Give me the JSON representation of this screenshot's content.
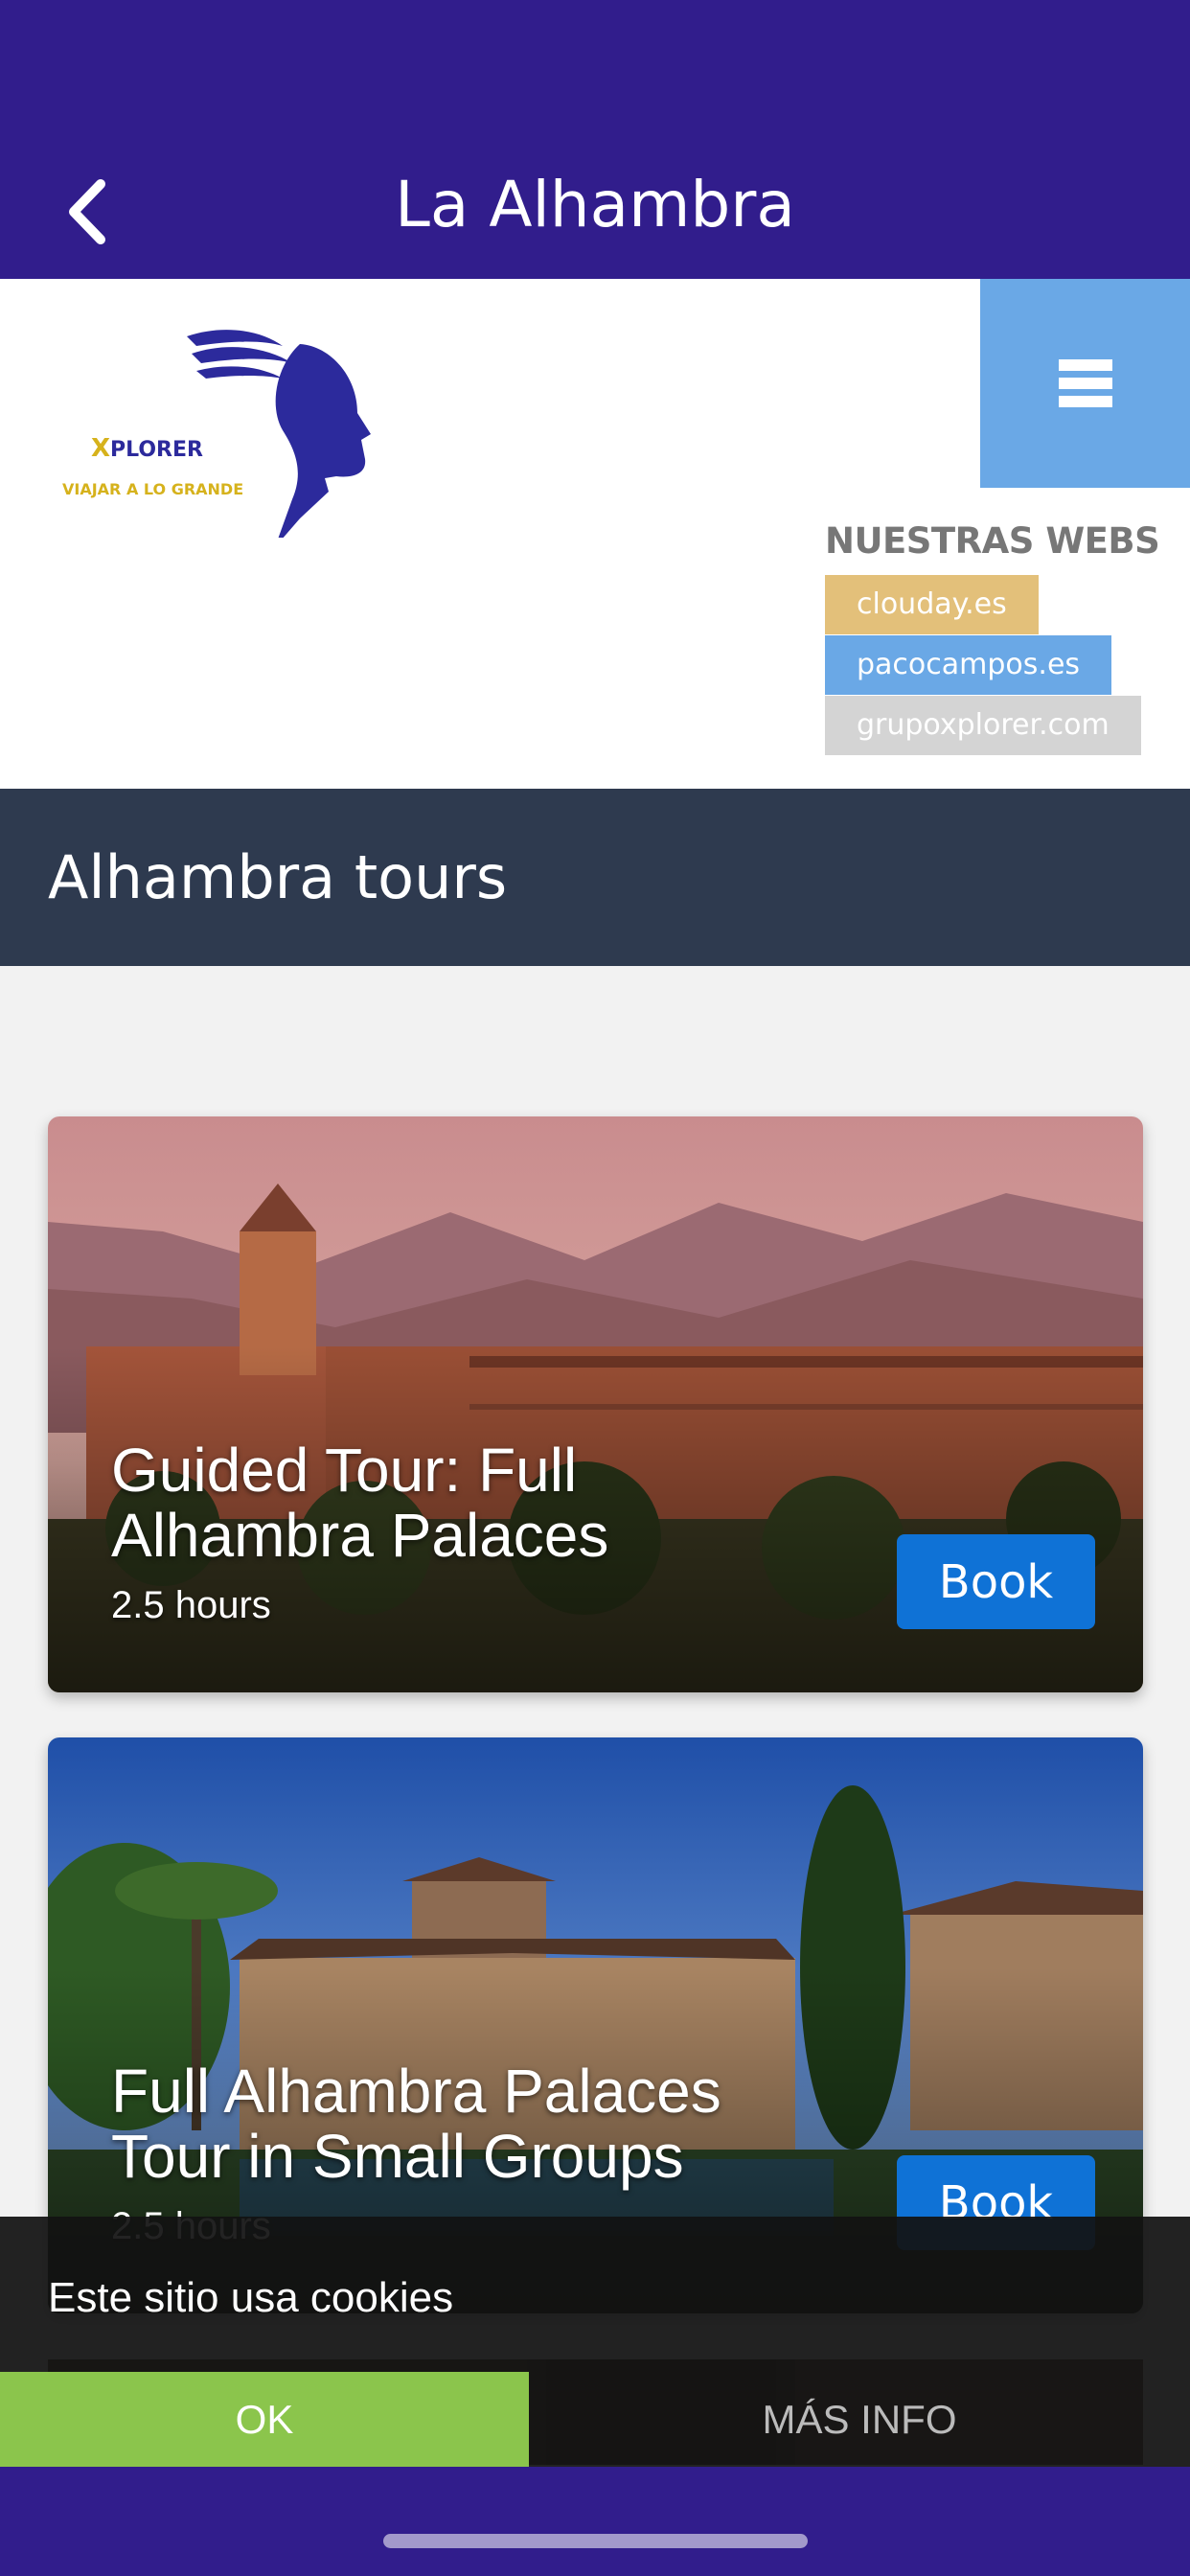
{
  "app": {
    "title": "La Alhambra",
    "accent": "#311d8c"
  },
  "logo": {
    "brand": "XPLORER",
    "tagline": "VIAJAR A LO GRANDE"
  },
  "webs": {
    "title": "NUESTRAS WEBS",
    "links": [
      {
        "label": "clouday.es",
        "color": "#e3c07a"
      },
      {
        "label": "pacocampos.es",
        "color": "#6aa8e6"
      },
      {
        "label": "grupoxplorer.com",
        "color": "#d4d4d4"
      }
    ]
  },
  "section": {
    "title": "Alhambra tours"
  },
  "tours": [
    {
      "title": "Guided Tour: Full Alhambra Palaces",
      "duration": "2.5 hours",
      "book_label": "Book"
    },
    {
      "title": "Full Alhambra Palaces Tour in Small Groups",
      "duration": "2.5 hours",
      "book_label": "Book"
    }
  ],
  "cookies": {
    "message": "Este sitio usa cookies",
    "ok_label": "OK",
    "more_label": "MÁS INFO"
  },
  "colors": {
    "section_bar": "#2e3a4f",
    "book_button": "#0f72d6",
    "cookie_ok": "#8bc54c",
    "menu_button": "#6aa8e6"
  }
}
